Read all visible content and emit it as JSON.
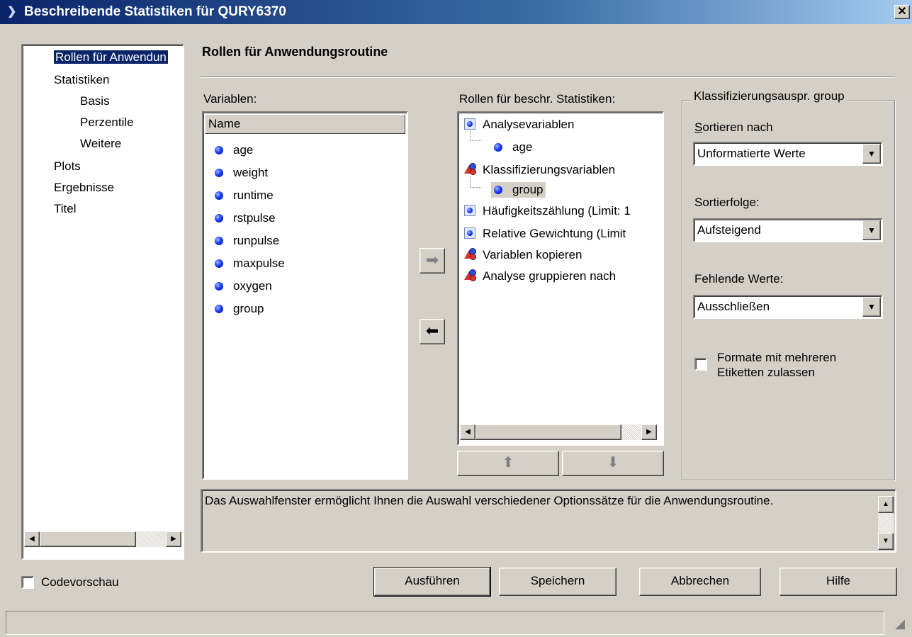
{
  "window": {
    "title": "Beschreibende Statistiken für QURY6370",
    "close_glyph": "✕"
  },
  "nav": {
    "items": [
      {
        "label": "Rollen für Anwendun",
        "selected": true
      },
      {
        "label": "Statistiken"
      },
      {
        "label": "Basis"
      },
      {
        "label": "Perzentile"
      },
      {
        "label": "Weitere"
      },
      {
        "label": "Plots"
      },
      {
        "label": "Ergebnisse"
      },
      {
        "label": "Titel"
      }
    ]
  },
  "main": {
    "heading": "Rollen für Anwendungsroutine",
    "variables_label": "Variablen:",
    "name_header": "Name",
    "variables": [
      "age",
      "weight",
      "runtime",
      "rstpulse",
      "runpulse",
      "maxpulse",
      "oxygen",
      "group"
    ],
    "roles_label": "Rollen für beschr. Statistiken:",
    "roles": {
      "analysis": "Analysevariablen",
      "analysis_child": "age",
      "classification": "Klassifizierungsvariablen",
      "classification_child": "group",
      "frequency": "Häufigkeitszählung (Limit: 1",
      "weight": "Relative Gewichtung (Limit",
      "copy": "Variablen kopieren",
      "group_by": "Analyse gruppieren nach"
    }
  },
  "groupbox": {
    "title": "Klassifizierungsauspr. group",
    "sort_by_label": "Sortieren nach",
    "sort_by_value": "Unformatierte Werte",
    "sort_order_label": "Sortierfolge:",
    "sort_order_value": "Aufsteigend",
    "missing_label": "Fehlende Werte:",
    "missing_value": "Ausschließen",
    "multilabel_line1": "Formate mit mehreren",
    "multilabel_line2": "Etiketten zulassen"
  },
  "description": "Das Auswahlfenster ermöglicht Ihnen die Auswahl verschiedener Optionssätze für die Anwendungsroutine.",
  "footer": {
    "code_preview": "Codevorschau",
    "run": "Ausführen",
    "save": "Speichern",
    "cancel": "Abbrechen",
    "help": "Hilfe"
  }
}
